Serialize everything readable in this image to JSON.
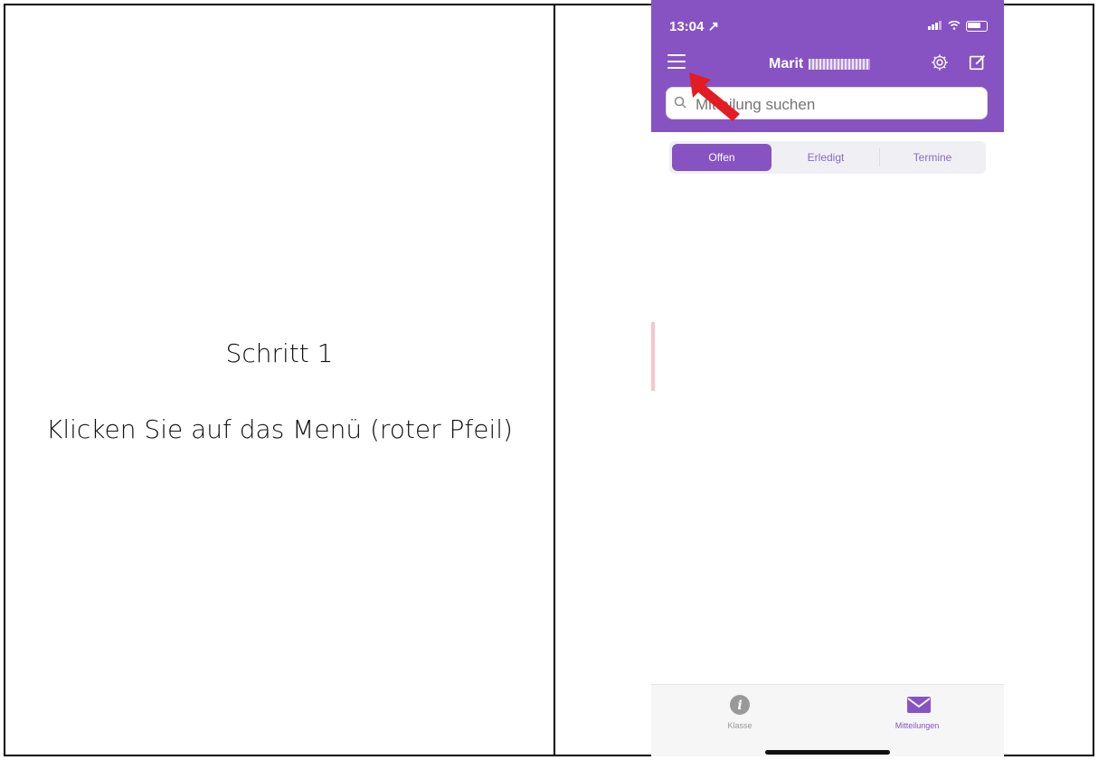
{
  "left": {
    "step_title": "Schritt 1",
    "step_text": "Klicken Sie auf das Menü (roter Pfeil)"
  },
  "phone": {
    "status": {
      "time": "13:04 ↗",
      "signal": "▮▮▮",
      "wifi": "WiFi"
    },
    "header": {
      "title": "Marit"
    },
    "search": {
      "placeholder": "Mitteilung suchen"
    },
    "tabs": [
      {
        "label": "Offen",
        "active": true
      },
      {
        "label": "Erledigt",
        "active": false
      },
      {
        "label": "Termine",
        "active": false
      }
    ],
    "bottom_nav": [
      {
        "label": "Klasse",
        "icon": "info-icon"
      },
      {
        "label": "Mitteilungen",
        "icon": "mail-icon"
      }
    ],
    "colors": {
      "brand": "#8753c3",
      "arrow": "#e31b23"
    }
  }
}
